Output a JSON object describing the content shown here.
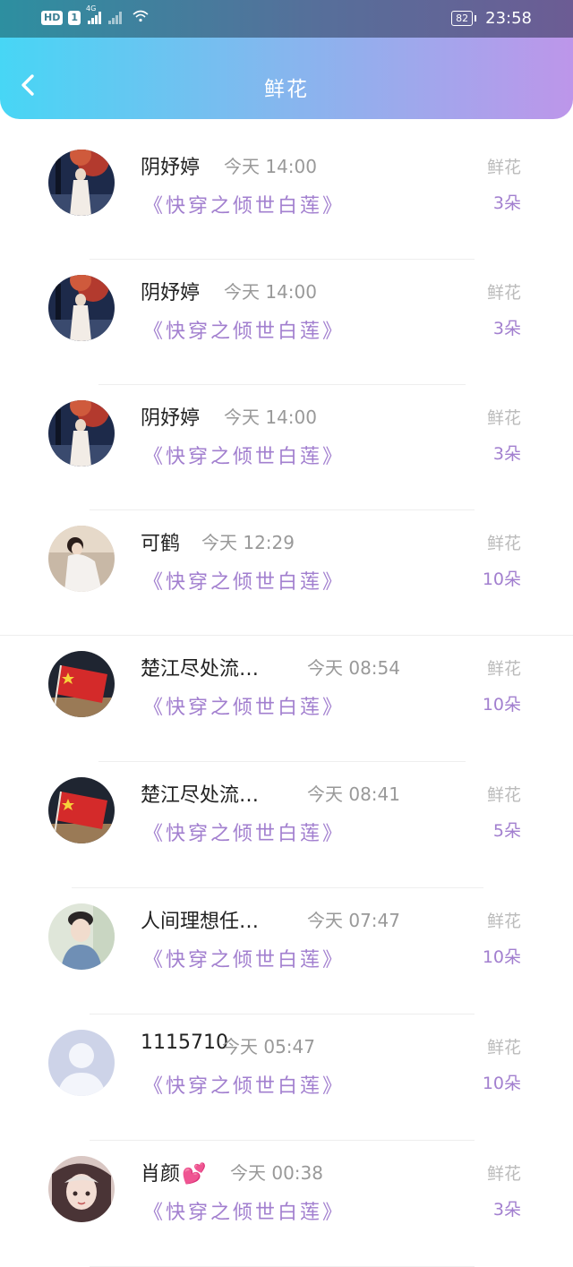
{
  "status_bar": {
    "hd": "HD",
    "sim": "1",
    "net": "4G",
    "battery": "82",
    "time": "23:58"
  },
  "header": {
    "title": "鲜花"
  },
  "colors": {
    "accent": "#a27fcf",
    "header_gradient_start": "#47d6f5",
    "header_gradient_end": "#bd96ea"
  },
  "items": [
    {
      "name": "阴妤婷",
      "time": "今天 14:00",
      "book": "《快穿之倾世白莲》",
      "tag": "鲜花",
      "count": "3朵",
      "avatar": "avatar-woman-red-tree"
    },
    {
      "name": "阴妤婷",
      "time": "今天 14:00",
      "book": "《快穿之倾世白莲》",
      "tag": "鲜花",
      "count": "3朵",
      "avatar": "avatar-woman-red-tree"
    },
    {
      "name": "阴妤婷",
      "time": "今天 14:00",
      "book": "《快穿之倾世白莲》",
      "tag": "鲜花",
      "count": "3朵",
      "avatar": "avatar-woman-red-tree"
    },
    {
      "name": "可鹤",
      "time": "今天 12:29",
      "book": "《快穿之倾世白莲》",
      "tag": "鲜花",
      "count": "10朵",
      "avatar": "avatar-girl-white-dress"
    },
    {
      "name": "楚江尽处流…",
      "time": "今天 08:54",
      "book": "《快穿之倾世白莲》",
      "tag": "鲜花",
      "count": "10朵",
      "avatar": "avatar-red-flag"
    },
    {
      "name": "楚江尽处流…",
      "time": "今天 08:41",
      "book": "《快穿之倾世白莲》",
      "tag": "鲜花",
      "count": "5朵",
      "avatar": "avatar-red-flag"
    },
    {
      "name": "人间理想任…",
      "time": "今天 07:47",
      "book": "《快穿之倾世白莲》",
      "tag": "鲜花",
      "count": "10朵",
      "avatar": "avatar-boy-photo"
    },
    {
      "name": "1115710",
      "time": "今天 05:47",
      "book": "《快穿之倾世白莲》",
      "tag": "鲜花",
      "count": "10朵",
      "avatar": "avatar-default-silhouette"
    },
    {
      "name": "肖颜",
      "time": "今天 00:38",
      "book": "《快穿之倾世白莲》",
      "tag": "鲜花",
      "count": "3朵",
      "avatar": "avatar-girl-illustration",
      "emoji": "💕"
    }
  ]
}
